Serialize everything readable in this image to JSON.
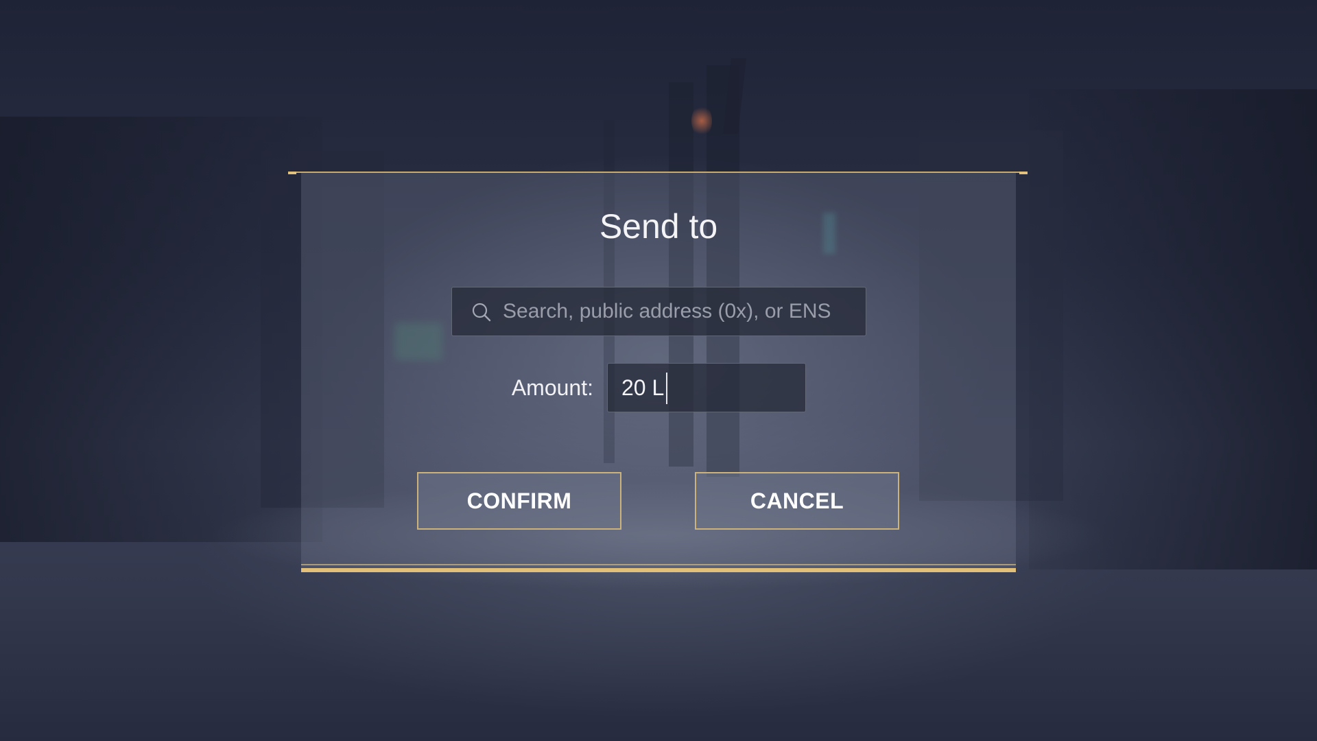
{
  "dialog": {
    "title": "Send to"
  },
  "search": {
    "placeholder": "Search, public address (0x), or ENS",
    "value": "",
    "icon": "search-icon"
  },
  "amount": {
    "label": "Amount:",
    "value": "20 L"
  },
  "buttons": {
    "confirm": "CONFIRM",
    "cancel": "CANCEL"
  },
  "colors": {
    "accent_gold": "#e2c07a",
    "text": "#f4f4f6",
    "placeholder": "#9a9eab"
  }
}
